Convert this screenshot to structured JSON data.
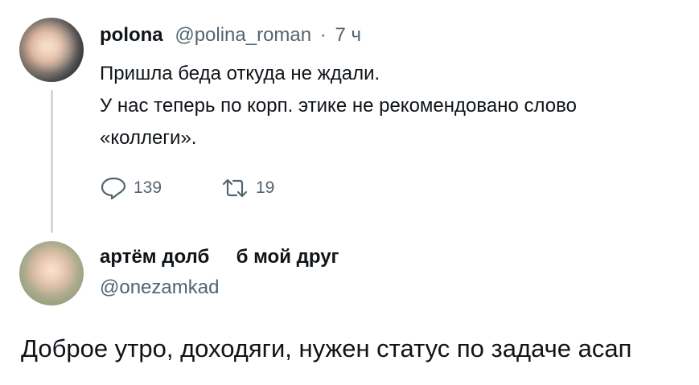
{
  "tweet1": {
    "author_name": "polona",
    "handle": "@polina_roman",
    "separator": "·",
    "time": "7 ч",
    "text_lines": [
      "Пришла беда откуда не ждали.",
      "У нас теперь по корп. этике не рекомендовано слово",
      "«коллеги»."
    ],
    "replies_count": "139",
    "retweets_count": "19"
  },
  "tweet2": {
    "author_name": "артём долб     б мой друг",
    "handle": "@onezamkad",
    "text": "Доброе утро, доходяги, нужен статус по задаче асап"
  },
  "colors": {
    "text": "#0f1419",
    "secondary": "#536471",
    "thread_line": "#cfd9de"
  },
  "icons": [
    "reply-icon",
    "retweet-icon"
  ]
}
